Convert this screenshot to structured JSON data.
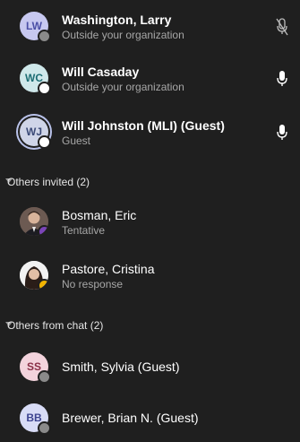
{
  "participants": [
    {
      "initials": "LW",
      "name": "Washington, Larry",
      "sub": "Outside your organization",
      "mic": "muted"
    },
    {
      "initials": "WC",
      "name": "Will Casaday",
      "sub": "Outside your organization",
      "mic": "on"
    },
    {
      "initials": "WJ",
      "name": "Will Johnston (MLI) (Guest)",
      "sub": "Guest",
      "mic": "on"
    }
  ],
  "sections": {
    "others_invited": "Others invited (2)",
    "others_from_chat": "Others from chat (2)"
  },
  "invited": [
    {
      "name": "Bosman, Eric",
      "sub": "Tentative"
    },
    {
      "name": "Pastore, Cristina",
      "sub": "No response"
    }
  ],
  "from_chat": [
    {
      "initials": "SS",
      "name": "Smith, Sylvia (Guest)"
    },
    {
      "initials": "BB",
      "name": "Brewer, Brian N. (Guest)"
    }
  ],
  "colors": {
    "background": "#1f1f1f",
    "subtext": "#a7a7a7",
    "tentative": "#7b44b8",
    "no_response": "#f1b400"
  }
}
